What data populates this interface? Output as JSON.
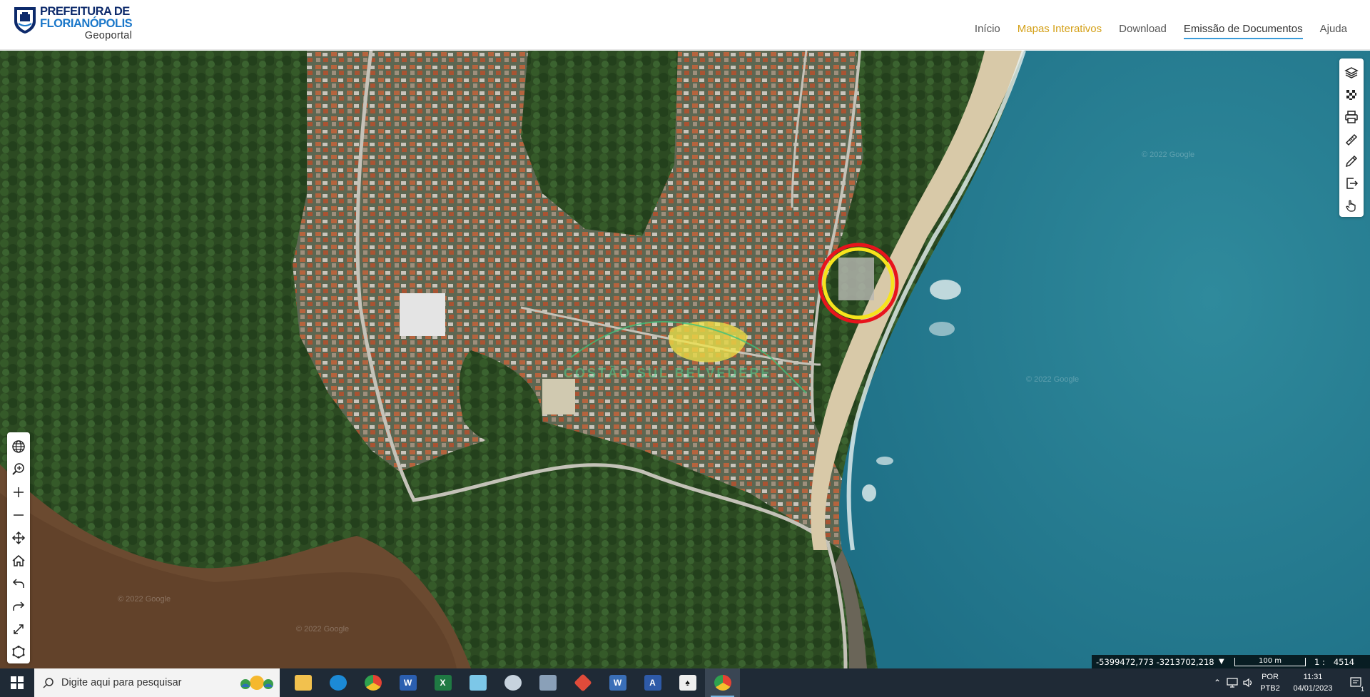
{
  "header": {
    "logo_line1": "PREFEITURA DE",
    "logo_line2": "FLORIANÓPOLIS",
    "logo_line3": "Geoportal",
    "nav": [
      {
        "label": "Início"
      },
      {
        "label": "Mapas Interativos"
      },
      {
        "label": "Download"
      },
      {
        "label": "Emissão de Documentos"
      },
      {
        "label": "Ajuda"
      }
    ],
    "active_color": "#d4a017",
    "underline_color": "#3a9bd9"
  },
  "map": {
    "area_label": "COSTÃO SUL BELVEDERE",
    "watermark": "© 2022 Google",
    "highlight_color": "#f2e44a",
    "circle_outer_color": "#e8141c",
    "circle_inner_color": "#f7e31c"
  },
  "right_toolbar": {
    "icons": [
      "layers-icon",
      "transparency-icon",
      "print-icon",
      "measure-icon",
      "draw-icon",
      "export-icon",
      "pointer-hand-icon"
    ]
  },
  "left_toolbar": {
    "icons": [
      "globe-icon",
      "zoom-search-icon",
      "zoom-in-icon",
      "zoom-out-icon",
      "pan-icon",
      "home-icon",
      "undo-icon",
      "redo-icon",
      "fullscreen-icon",
      "extent-icon"
    ]
  },
  "coordinates": {
    "value": "-5399472,773 -3213702,218",
    "scale_label": "100 m",
    "ratio_prefix": "1 :",
    "ratio_value": "4514"
  },
  "taskbar": {
    "search_placeholder": "Digite aqui para pesquisar",
    "lang_line1": "POR",
    "lang_line2": "PTB2",
    "time": "11:31",
    "date": "04/01/2023",
    "notification_count": "1"
  }
}
